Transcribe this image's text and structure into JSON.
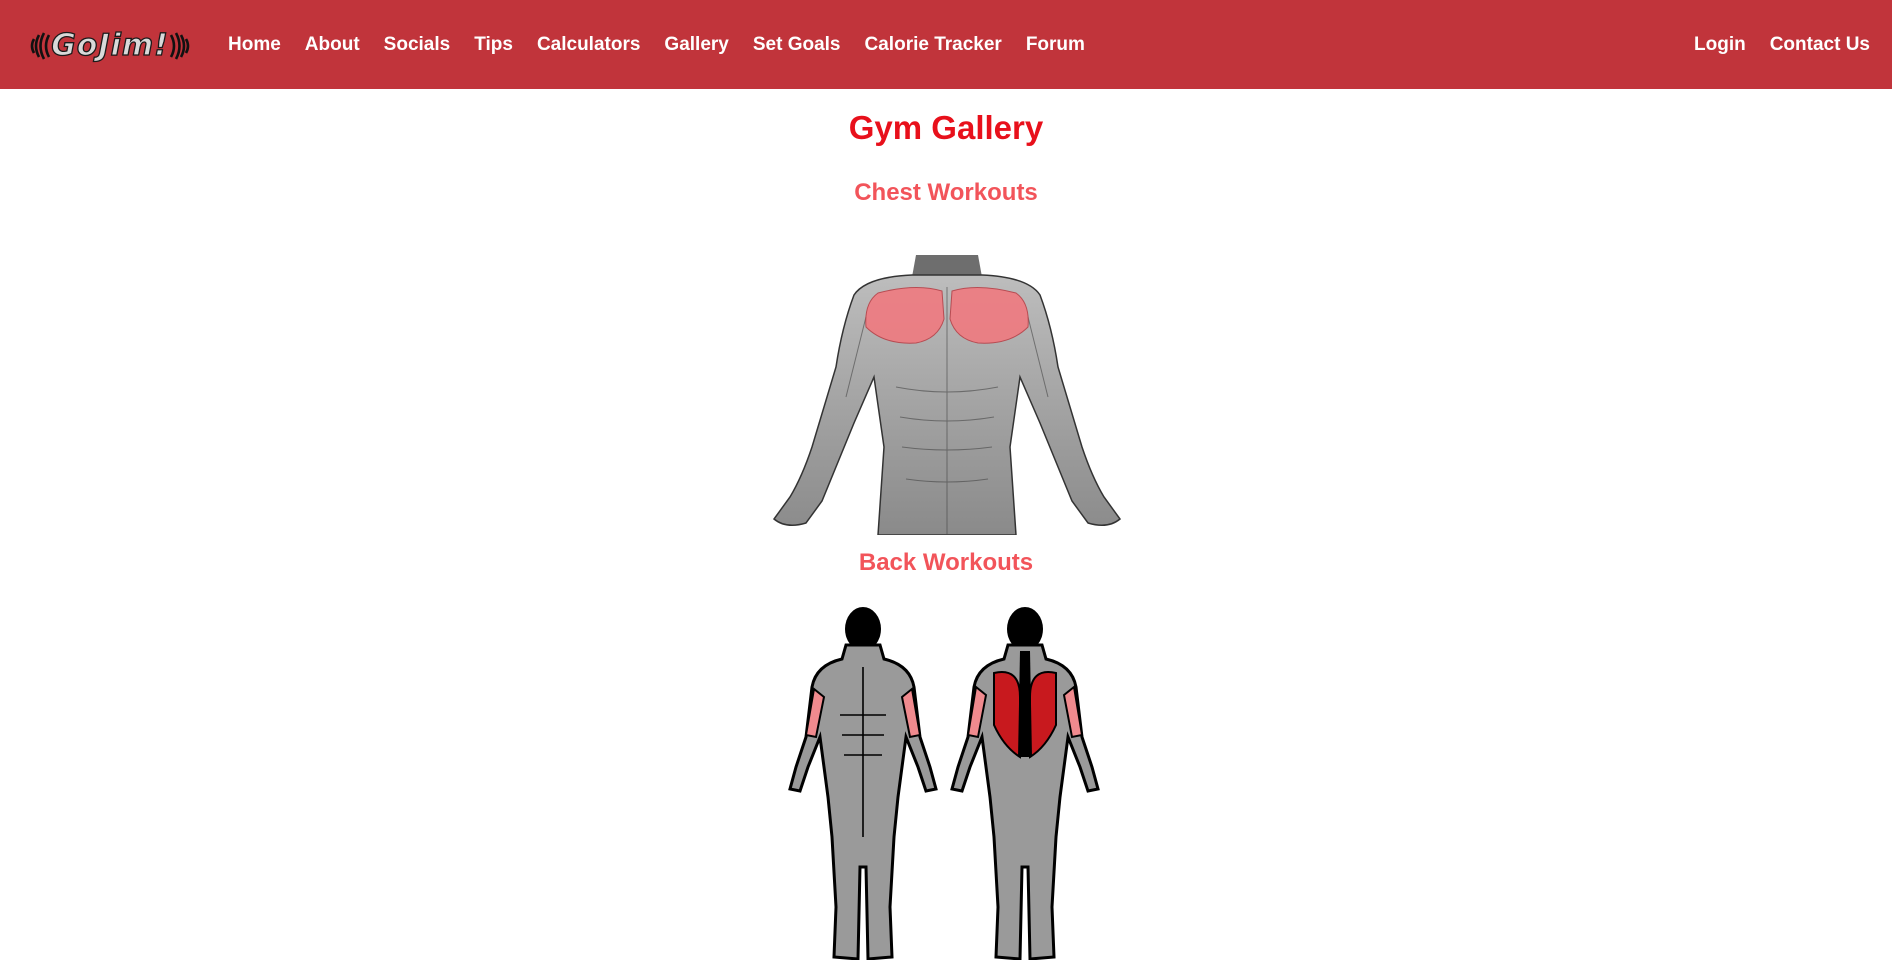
{
  "brand": {
    "logo_text": "GoJim!"
  },
  "nav": {
    "items": [
      {
        "label": "Home"
      },
      {
        "label": "About"
      },
      {
        "label": "Socials"
      },
      {
        "label": "Tips"
      },
      {
        "label": "Calculators"
      },
      {
        "label": "Gallery"
      },
      {
        "label": "Set Goals"
      },
      {
        "label": "Calorie Tracker"
      },
      {
        "label": "Forum"
      }
    ],
    "right_items": [
      {
        "label": "Login"
      },
      {
        "label": "Contact Us"
      }
    ]
  },
  "main": {
    "title": "Gym Gallery",
    "sections": [
      {
        "heading": "Chest Workouts"
      },
      {
        "heading": "Back Workouts"
      }
    ]
  },
  "colors": {
    "navbar": "#c1343b",
    "title": "#e8101b",
    "section_heading": "#f2545a",
    "muscle_highlight": "#f07a80",
    "muscle_primary": "#c8191e"
  }
}
